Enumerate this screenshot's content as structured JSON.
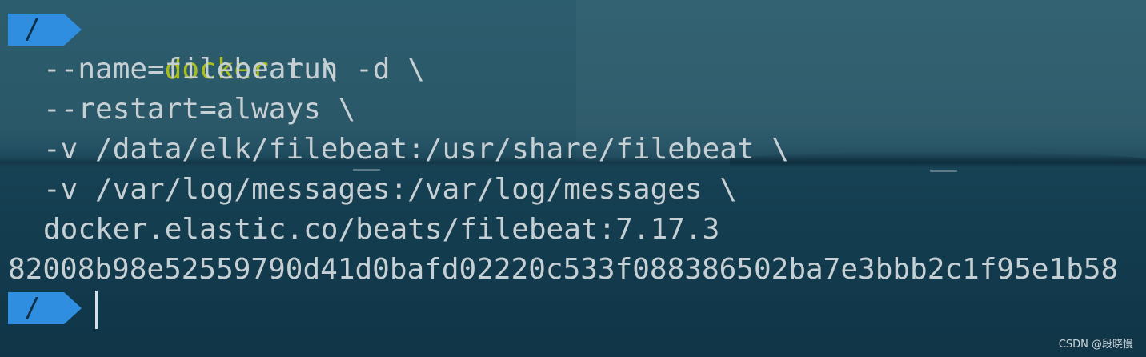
{
  "prompt": {
    "path": "/",
    "color": "#2f8ee0"
  },
  "command": {
    "name": "docker",
    "rest": " run -d \\",
    "args": [
      "--name=filebeat \\",
      "--restart=always \\",
      "-v /data/elk/filebeat:/usr/share/filebeat \\",
      "-v /var/log/messages:/var/log/messages \\",
      "docker.elastic.co/beats/filebeat:7.17.3"
    ]
  },
  "output": "82008b98e52559790d41d0bafd02220c533f088386502ba7e3bbb2c1f95e1b58",
  "second_prompt": {
    "path": "/"
  },
  "watermark": "CSDN @段晓慢",
  "colors": {
    "command": "#a8bf1a",
    "text": "#c6d0d4",
    "background": "#1d4a5c"
  }
}
